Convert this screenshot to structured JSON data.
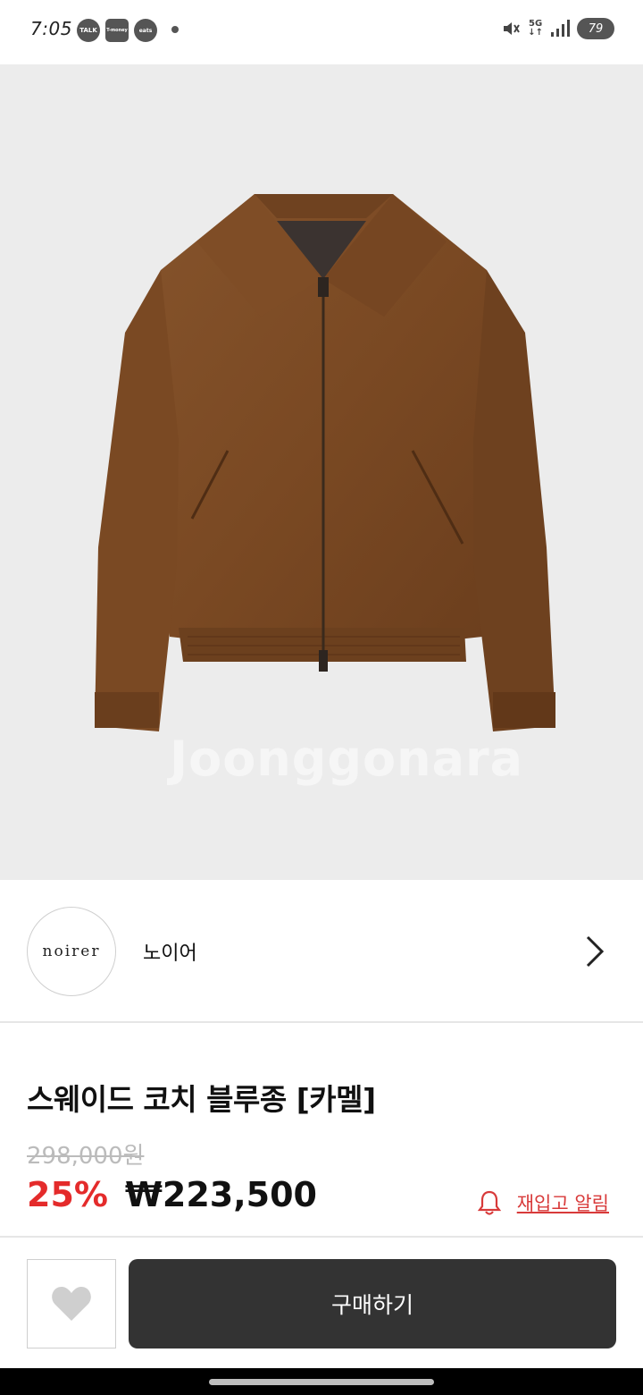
{
  "status_bar": {
    "time": "7:05",
    "notifications": [
      "TALK",
      "T-money",
      "eats"
    ],
    "network": "5G",
    "battery": "79"
  },
  "product_image": {
    "watermark": "Joonggonara",
    "background_color": "#ececec",
    "jacket_color": "#7b4a24"
  },
  "seller": {
    "logo_text": "noirer",
    "name": "노이어"
  },
  "product": {
    "title": "스웨이드 코치 블루종 [카멜]",
    "original_price": "298,000원",
    "discount_rate": "25%",
    "sale_price": "₩223,500",
    "restock_alert_label": "재입고 알림"
  },
  "actions": {
    "buy_label": "구매하기"
  },
  "colors": {
    "accent_red": "#e42b2b",
    "buy_button": "#333333"
  }
}
